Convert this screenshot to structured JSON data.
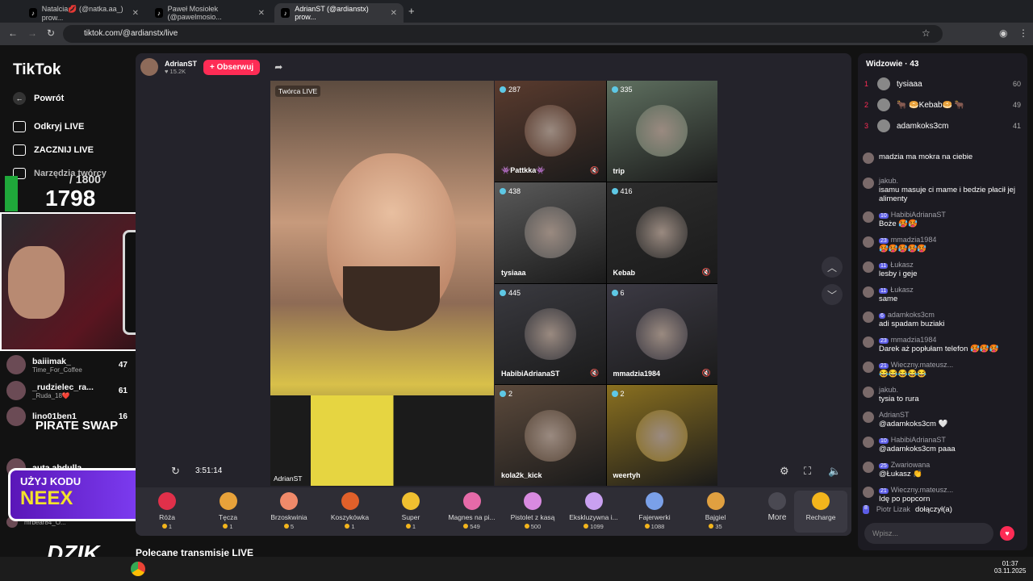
{
  "browser": {
    "tabs": [
      {
        "label": "Natalcia💋 (@natka.aa_) prow...",
        "active": false
      },
      {
        "label": "Paweł Mosiołek (@pawelmosio...",
        "active": false
      },
      {
        "label": "AdrianST (@ardianstx) prow...",
        "active": true
      }
    ],
    "url": "tiktok.com/@ardianstx/live"
  },
  "sidebar": {
    "logo": "TikTok",
    "back": "Powrót",
    "items": [
      "Odkryj LIVE",
      "ZACZNIJ LIVE",
      "Narzędzia twórcy"
    ],
    "following": [
      {
        "name": "baiiimak_",
        "sub": "Time_For_Coffee",
        "count": "47"
      },
      {
        "name": "_rudzielec_ra...",
        "sub": "_Ruda_18❤️",
        "count": "61"
      },
      {
        "name": "lino01ben1",
        "sub": "",
        "count": "16"
      },
      {
        "name": "auta.abdulla...",
        "sub": "",
        "count": ""
      },
      {
        "name": "mrbear84_O...",
        "sub": "",
        "count": ""
      }
    ]
  },
  "overlays": {
    "counter_goal": "/ 1800",
    "counter_value": "1798",
    "pirate": "PIRATE SWAP",
    "promo_line1": "UŻYJ KODU",
    "promo_line2": "NEEX",
    "dzik": "DZIK"
  },
  "host": {
    "name": "AdrianST",
    "likes": "15.2K",
    "follow": "+ Obserwuj"
  },
  "stream": {
    "creator_badge": "Twórca LIVE",
    "creator_name": "AdrianST",
    "timer": "3:51:14",
    "guests": [
      {
        "score": "287",
        "name": "👾Pattkka👾",
        "muted": true,
        "color": "#5a3b2e"
      },
      {
        "score": "335",
        "name": "trip",
        "muted": false,
        "color": "#5f7060"
      },
      {
        "score": "438",
        "name": "tysiaaa",
        "muted": false,
        "color": "#5a5a5a"
      },
      {
        "score": "416",
        "name": "Kebab",
        "muted": true,
        "color": "#2d2d2d"
      },
      {
        "score": "445",
        "name": "HabibiAdrianaST",
        "muted": true,
        "color": "#3a3a40"
      },
      {
        "score": "6",
        "name": "mmadzia1984",
        "muted": true,
        "color": "#3c3a44"
      },
      {
        "score": "2",
        "name": "kola2k_kick",
        "muted": false,
        "color": "#5c4a3c"
      },
      {
        "score": "2",
        "name": "weertyh",
        "muted": false,
        "color": "#8a7020"
      }
    ]
  },
  "gifts": [
    {
      "name": "Róża",
      "price": "1",
      "color": "#e0304a"
    },
    {
      "name": "Tęcza",
      "price": "1",
      "color": "#e8a23a"
    },
    {
      "name": "Brzoskwinia",
      "price": "5",
      "color": "#f08a6a"
    },
    {
      "name": "Koszykówka",
      "price": "1",
      "color": "#e0602a"
    },
    {
      "name": "Super",
      "price": "1",
      "color": "#f0c030"
    },
    {
      "name": "Magnes na pi...",
      "price": "549",
      "color": "#e56aa8"
    },
    {
      "name": "Pistolet z kasą",
      "price": "500",
      "color": "#d88ae0"
    },
    {
      "name": "Ekskluzywna i...",
      "price": "1099",
      "color": "#c9a0f0"
    },
    {
      "name": "Fajerwerki",
      "price": "1088",
      "color": "#7aa0e8"
    },
    {
      "name": "Bajgiel",
      "price": "35",
      "color": "#e0a040"
    }
  ],
  "gift_more": "More",
  "recharge": "Recharge",
  "below_title": "Polecane transmisje LIVE",
  "chat": {
    "viewers_title": "Widzowie · 43",
    "top": [
      {
        "rank": "1",
        "name": "tysiaaa",
        "pts": "60"
      },
      {
        "rank": "2",
        "name": "🐂 🥯Kebab🥯 🐂",
        "pts": "49"
      },
      {
        "rank": "3",
        "name": "adamkoks3cm",
        "pts": "41"
      }
    ],
    "messages": [
      {
        "name": "",
        "text": "madzia ma mokra na ciebie",
        "lvl": ""
      },
      {
        "name": "jakub.",
        "text": "isamu masuje ci mame i bedzie płacił jej alimenty",
        "lvl": ""
      },
      {
        "name": "HabibiAdrianaST",
        "text": "Boże 🥵🥵",
        "lvl": "10"
      },
      {
        "name": "mmadzia1984",
        "text": "🥵🥵🥵🥵🥵",
        "lvl": "23"
      },
      {
        "name": "Łukasz",
        "text": "lesby i geje",
        "lvl": "11"
      },
      {
        "name": "Łukasz",
        "text": "same",
        "lvl": "11"
      },
      {
        "name": "adamkoks3cm",
        "text": "adi spadam buziaki",
        "lvl": "6"
      },
      {
        "name": "mmadzia1984",
        "text": "Darek aż popłułam telefon 🥵🥵🥵",
        "lvl": "23"
      },
      {
        "name": "Wieczny.mateusz...",
        "text": "😂😂😂😂😂",
        "lvl": "21"
      },
      {
        "name": "jakub.",
        "text": "tysia to rura",
        "lvl": ""
      },
      {
        "name": "AdrianST",
        "text": "@adamkoks3cm 🤍",
        "lvl": ""
      },
      {
        "name": "HabibiAdrianaST",
        "text": "@adamkoks3cm paaa",
        "lvl": "10"
      },
      {
        "name": "Zwariowana",
        "text": "@Łukasz 👏",
        "lvl": "25"
      },
      {
        "name": "Wieczny.mateusz...",
        "text": "Idę po popcorn",
        "lvl": "21"
      }
    ],
    "join": {
      "name": "Piotr Lizak",
      "text": "dołączył(a)",
      "lvl": "8"
    },
    "input_placeholder": "Wpisz..."
  },
  "taskbar": {
    "time": "01:37",
    "date": "03.11.2025"
  }
}
